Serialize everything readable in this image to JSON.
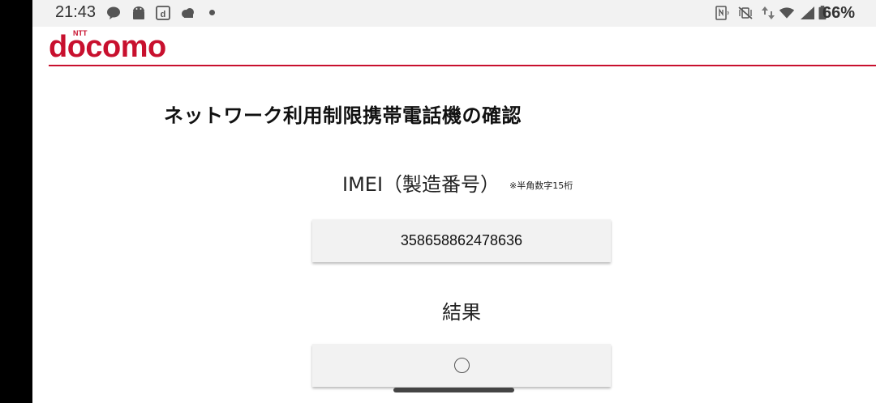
{
  "status_bar": {
    "time": "21:43",
    "battery": "66%",
    "icons_left": [
      "chat-icon",
      "android-icon",
      "docomo-d-icon",
      "cloud-icon",
      "notification-dot"
    ],
    "icons_right": [
      "nfc-icon",
      "vibrate-mute-icon",
      "data-arrows-icon",
      "wifi-icon",
      "cell-signal-icon",
      "battery-icon"
    ]
  },
  "brand": {
    "logo_text": "docomo",
    "logo_superscript": "NTT",
    "color": "#c8102e"
  },
  "page": {
    "title": "ネットワーク利用制限携帯電話機の確認",
    "imei_label": "IMEI（製造番号）",
    "imei_note": "※半角数字15桁",
    "imei_value": "358658862478636",
    "result_label": "結果",
    "result_value": "○"
  }
}
